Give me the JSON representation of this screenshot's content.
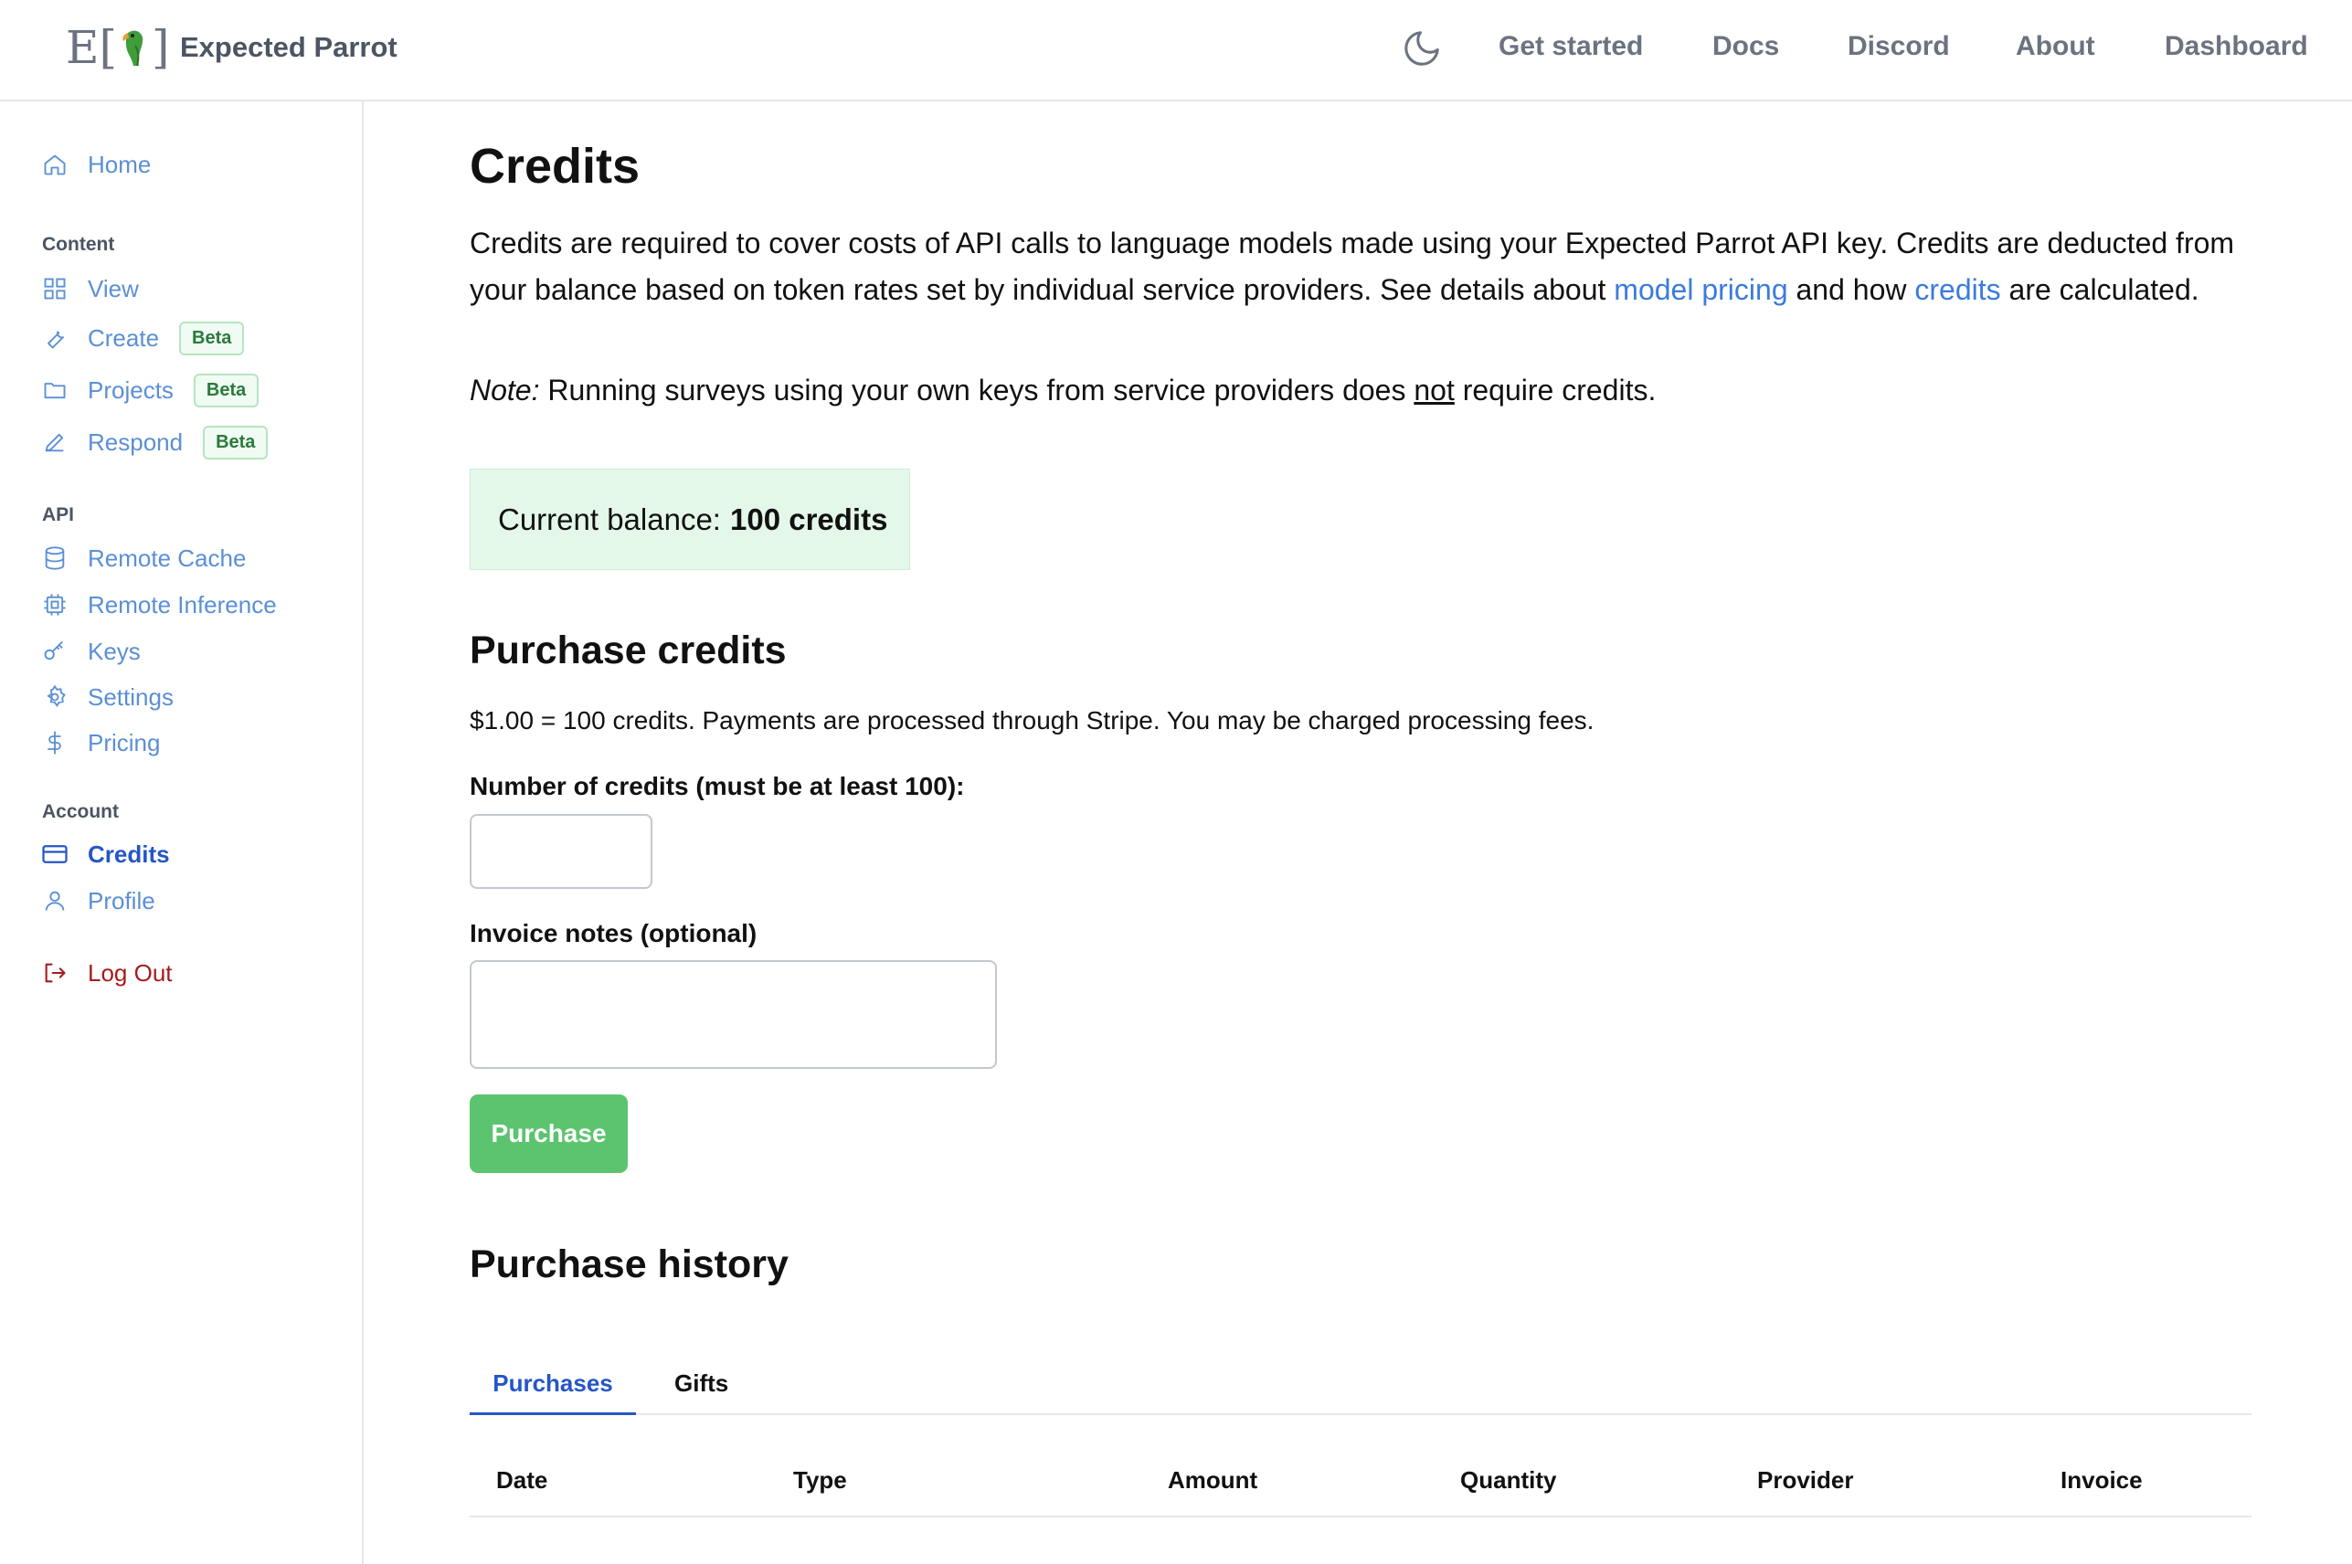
{
  "header": {
    "logo_letter": "E",
    "brand": "Expected Parrot",
    "nav": [
      "Get started",
      "Docs",
      "Discord",
      "About",
      "Dashboard"
    ],
    "theme_icon": "moon-icon"
  },
  "sidebar": {
    "home": "Home",
    "content_section": "Content",
    "view": "View",
    "create": "Create",
    "projects": "Projects",
    "respond": "Respond",
    "beta": "Beta",
    "api_section": "API",
    "remote_cache": "Remote Cache",
    "remote_inference": "Remote Inference",
    "keys": "Keys",
    "settings": "Settings",
    "pricing": "Pricing",
    "account_section": "Account",
    "credits": "Credits",
    "profile": "Profile",
    "logout": "Log Out"
  },
  "main": {
    "title": "Credits",
    "intro_part1": "Credits are required to cover costs of API calls to language models made using your Expected Parrot API key. Credits are deducted from your balance based on token rates set by individual service providers. See details about ",
    "model_pricing_link": "model pricing",
    "intro_part2": " and how ",
    "credits_link": "credits",
    "intro_part3": " are calculated.",
    "note_label": "Note:",
    "note_part1": " Running surveys using your own keys from service providers does ",
    "note_emph": "not",
    "note_part2": " require credits.",
    "balance_label": "Current balance:",
    "balance_value": "100 credits",
    "purchase_heading": "Purchase credits",
    "rate_text": "$1.00 = 100 credits. Payments are processed through Stripe. You may be charged processing fees.",
    "credits_field_label": "Number of credits (must be at least 100):",
    "credits_field_value": "",
    "notes_field_label": "Invoice notes (optional)",
    "notes_field_value": "",
    "purchase_button": "Purchase",
    "history_heading": "Purchase history",
    "tabs": [
      "Purchases",
      "Gifts"
    ],
    "columns": [
      "Date",
      "Type",
      "Amount",
      "Quantity",
      "Provider",
      "Invoice"
    ]
  }
}
